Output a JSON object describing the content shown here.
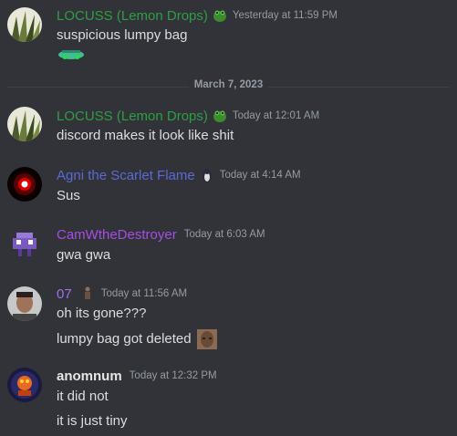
{
  "date_divider": "March 7, 2023",
  "colors": {
    "background": "#313338",
    "locuss": "#2f9e44",
    "agni": "#5b69d6",
    "camw": "#a64de6",
    "seven": "#a06ee8",
    "anomnum": "#e6e6e6"
  },
  "messages": [
    {
      "username": "LOCUSS (Lemon Drops)",
      "role_icon": "frog-icon",
      "timestamp": "Yesterday at 11:59 PM",
      "lines": [
        "suspicious lumpy bag"
      ],
      "extra": "bag-sticker-icon"
    },
    {
      "username": "LOCUSS (Lemon Drops)",
      "role_icon": "frog-icon",
      "timestamp": "Today at 12:01 AM",
      "lines": [
        "discord makes it look like shit"
      ]
    },
    {
      "username": "Agni the Scarlet Flame",
      "role_icon": "penguin-icon",
      "timestamp": "Today at 4:14 AM",
      "lines": [
        "Sus"
      ]
    },
    {
      "username": "CamWtheDestroyer",
      "timestamp": "Today at 6:03 AM",
      "lines": [
        "gwa gwa"
      ]
    },
    {
      "username": "07",
      "role_icon": "figure-icon",
      "timestamp": "Today at 11:56 AM",
      "lines": [
        "oh its gone???",
        "lumpy bag got deleted"
      ]
    },
    {
      "username": "anomnum",
      "timestamp": "Today at 12:32 PM",
      "lines": [
        "it did not",
        "it is just tiny"
      ]
    }
  ]
}
